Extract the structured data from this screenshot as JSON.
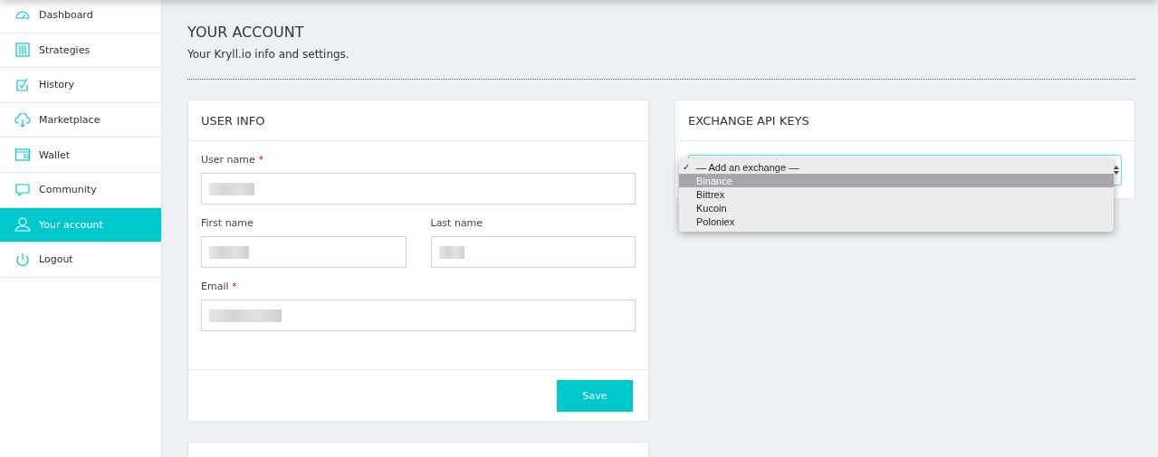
{
  "sidebar": {
    "items": [
      {
        "label": "Dashboard",
        "selected": false
      },
      {
        "label": "Strategies",
        "selected": false
      },
      {
        "label": "History",
        "selected": false
      },
      {
        "label": "Marketplace",
        "selected": false
      },
      {
        "label": "Wallet",
        "selected": false
      },
      {
        "label": "Community",
        "selected": false
      },
      {
        "label": "Your account",
        "selected": true
      },
      {
        "label": "Logout",
        "selected": false
      }
    ]
  },
  "page": {
    "title": "YOUR ACCOUNT",
    "subtitle": "Your Kryll.io info and settings."
  },
  "user_info": {
    "title": "USER INFO",
    "required_mark": "*",
    "fields": [
      {
        "label": "User name",
        "required": true
      },
      {
        "label": "First name",
        "required": false
      },
      {
        "label": "Last name",
        "required": false
      },
      {
        "label": "Email",
        "required": true
      }
    ],
    "save_button": "Save"
  },
  "exchange_api_keys": {
    "title": "EXCHANGE API KEYS",
    "dropdown": {
      "check_mark": "✓",
      "options": [
        {
          "label": "— Add an exchange —",
          "checked": true,
          "selected": false
        },
        {
          "label": "Binance",
          "checked": false,
          "selected": true
        },
        {
          "label": "Bittrex",
          "checked": false,
          "selected": false
        },
        {
          "label": "Kucoin",
          "checked": false,
          "selected": false
        },
        {
          "label": "Poloniex",
          "checked": false,
          "selected": false
        }
      ]
    }
  }
}
